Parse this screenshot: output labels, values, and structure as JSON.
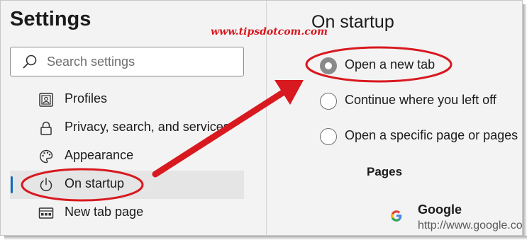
{
  "left": {
    "title": "Settings",
    "search": {
      "placeholder": "Search settings"
    },
    "items": [
      {
        "label": "Profiles",
        "icon": "profile-icon"
      },
      {
        "label": "Privacy, search, and services",
        "icon": "lock-icon"
      },
      {
        "label": "Appearance",
        "icon": "palette-icon"
      },
      {
        "label": "On startup",
        "icon": "power-icon",
        "active": true
      },
      {
        "label": "New tab page",
        "icon": "new-tab-page-icon"
      }
    ]
  },
  "right": {
    "title": "On startup",
    "options": [
      {
        "label": "Open a new tab",
        "checked": true
      },
      {
        "label": "Continue where you left off",
        "checked": false
      },
      {
        "label": "Open a specific page or pages",
        "checked": false
      }
    ],
    "pages_label": "Pages",
    "page_entry": {
      "name": "Google",
      "url": "http://www.google.co",
      "icon": "google-g-icon"
    }
  },
  "watermark": "www.tipsdotcom.com",
  "annotation": {
    "color": "#d8191f",
    "shapes": [
      "ellipse-on-startup",
      "ellipse-open-new-tab",
      "arrow"
    ]
  }
}
